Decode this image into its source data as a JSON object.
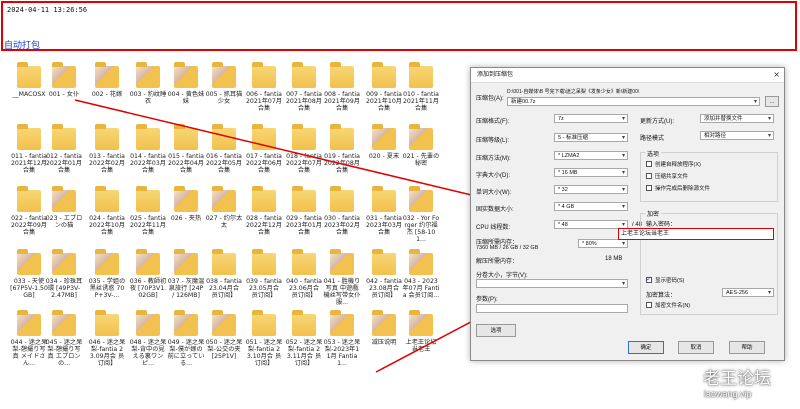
{
  "topbar": {
    "timestamp": "2024-04-11   13:26:56",
    "autopack": "自动打包"
  },
  "explorer": {
    "items": [
      {
        "label": "__MACOSX",
        "kind": "folder"
      },
      {
        "label": "001 - 女仆",
        "kind": "thumb"
      },
      {
        "label": "002 - 花嫁",
        "kind": "thumb"
      },
      {
        "label": "003 - 豹纹睡衣",
        "kind": "thumb"
      },
      {
        "label": "004 - 黄色妹妹",
        "kind": "thumb"
      },
      {
        "label": "005 - 抓耳猫少女",
        "kind": "thumb"
      },
      {
        "label": "006 - fantia 2021年07月合集",
        "kind": "folder"
      },
      {
        "label": "007 - fantia 2021年08月合集",
        "kind": "folder"
      },
      {
        "label": "008 - fantia 2021年09月合集",
        "kind": "folder"
      },
      {
        "label": "009 - fantia 2021年10月合集",
        "kind": "folder"
      },
      {
        "label": "010 - fantia 2021年11月合集",
        "kind": "folder"
      },
      {
        "label": "011 - fantia 2021年12月合集",
        "kind": "folder"
      },
      {
        "label": "012 - fantia 2022年01月合集",
        "kind": "folder"
      },
      {
        "label": "013 - fantia 2022年02月合集",
        "kind": "folder"
      },
      {
        "label": "014 - fantia 2022年03月合集",
        "kind": "folder"
      },
      {
        "label": "015 - fantia 2022年04月合集",
        "kind": "folder"
      },
      {
        "label": "016 - fantia 2022年05月合集",
        "kind": "folder"
      },
      {
        "label": "017 - fantia 2022年06月合集",
        "kind": "folder"
      },
      {
        "label": "018 - fantia 2022年07月合集",
        "kind": "folder"
      },
      {
        "label": "019 - fantia 2022年08月合集",
        "kind": "folder"
      },
      {
        "label": "020 - 夏末",
        "kind": "thumb"
      },
      {
        "label": "021 - 先輩の秘密",
        "kind": "thumb"
      },
      {
        "label": "022 - fantia 2022年09月合集",
        "kind": "folder"
      },
      {
        "label": "023 - エプロンの猫",
        "kind": "thumb"
      },
      {
        "label": "024 - fantia 2022年10月合集",
        "kind": "folder"
      },
      {
        "label": "025 - fantia 2022年11月合集",
        "kind": "folder"
      },
      {
        "label": "026 - 夹热",
        "kind": "thumb"
      },
      {
        "label": "027 - 约尔太太",
        "kind": "thumb"
      },
      {
        "label": "028 - fantia 2022年12月合集",
        "kind": "folder"
      },
      {
        "label": "029 - fantia 2023年01月合集",
        "kind": "folder"
      },
      {
        "label": "030 - fantia 2023年02月合集",
        "kind": "folder"
      },
      {
        "label": "031 - fantia 2023年03月合集",
        "kind": "folder"
      },
      {
        "label": "032 - Yor Forger 约尔福杰 [58-101...",
        "kind": "thumb"
      },
      {
        "label": "033 - 天使 [67P5V-1.50GB]",
        "kind": "thumb"
      },
      {
        "label": "034 - 珍珠耳環 [49P3V-2.47MB]",
        "kind": "thumb"
      },
      {
        "label": "035 - 学姐の黑丝诱惑 70P+3V-...",
        "kind": "thumb"
      },
      {
        "label": "036 - 教師初夜 [70P3V1.02GB]",
        "kind": "thumb"
      },
      {
        "label": "037 - 灰魔温泉旅行 [24P / 126MB]",
        "kind": "thumb"
      },
      {
        "label": "038 - fantia 23.04月合 员订阅】",
        "kind": "folder"
      },
      {
        "label": "039 - fantia 23.05月合 员订阅】",
        "kind": "folder"
      },
      {
        "label": "040 - fantia 23.06月合 员订阅】",
        "kind": "folder"
      },
      {
        "label": "041 - 胜機り写真 中遊戲機丝写带女仆服...",
        "kind": "thumb"
      },
      {
        "label": "042 - fantia 23.08月合 员订阅】",
        "kind": "folder"
      },
      {
        "label": "043 - 2023年07月 Fantia 会员订阅...",
        "kind": "thumb"
      },
      {
        "label": "044 - 迷之呆梨-憩撮り写真 メイドさん...",
        "kind": "thumb"
      },
      {
        "label": "045 - 迷之呆梨-憩撮り写真 エプロンの...",
        "kind": "thumb"
      },
      {
        "label": "046 - 迷之呆梨-fantia 23.09月会 员订阅】",
        "kind": "folder"
      },
      {
        "label": "048 - 迷之呆梨-背中の見える裏ワンピ...",
        "kind": "thumb"
      },
      {
        "label": "049 - 迷之呆梨-僕が嫁の前に立っている...",
        "kind": "thumb"
      },
      {
        "label": "050 - 迷之呆梨-公交の夹 [25P1V]",
        "kind": "thumb"
      },
      {
        "label": "051 - 迷之呆梨-fantia 23.10月合 员订阅】",
        "kind": "folder"
      },
      {
        "label": "052 - 迷之呆梨-fantia 23.11月合 员订阅】",
        "kind": "folder"
      },
      {
        "label": "053 - 迷之呆梨-2023年11月 Fantia 1...",
        "kind": "thumb"
      },
      {
        "label": "减压说明",
        "kind": "thumb"
      },
      {
        "label": "上老王论坛 当老王",
        "kind": "thumb"
      }
    ]
  },
  "dialog": {
    "title": "添加到压缩包",
    "close": "×",
    "archive_label": "压缩包(A):",
    "archive_path": "D:\\001-自媒体\\B 号完下载\\迷之呆梨《发条少女》新\\新建00\\",
    "archive_name": "新建00.7z",
    "browse": "...",
    "format_label": "压缩格式(F):",
    "format_value": "7z",
    "level_label": "压缩等级(L):",
    "level_value": "5 - 标准压缩",
    "method_label": "压缩方法(M):",
    "method_value": "* LZMA2",
    "dict_label": "字典大小(D):",
    "dict_value": "* 16 MB",
    "word_label": "单词大小(W):",
    "word_value": "* 32",
    "solid_label": "固实数据大小:",
    "solid_value": "* 4 GB",
    "cpu_label": "CPU 线程数:",
    "cpu_value": "* 48",
    "cpu_max": "/ 48",
    "mem_label": "压缩所需内存：",
    "mem_value": "7360 MB / 26 GB / 32 GB",
    "mem_pct": "* 80%",
    "decomp_label": "解压所需内存：",
    "decomp_value": "18 MB",
    "split_label": "分卷大小，字节(V):",
    "params_label": "参数(P):",
    "options_btn": "选项",
    "update_label": "更新方式(U):",
    "update_value": "添加并替换文件",
    "path_label": "路径模式",
    "path_value": "相对路径",
    "opts_title": "选项",
    "opt1": "创建自释放程序(X)",
    "opt2": "压缩共享文件",
    "opt3": "操作完成后删除源文件",
    "enc_title": "加密",
    "pw_label": "输入密码：",
    "pw_value": "上老王论坛当老王",
    "show_pw": "显示密码(S)",
    "enc_method_label": "加密算法：",
    "enc_method_value": "AES-256",
    "enc_names": "加密文件名(N)",
    "ok": "确定",
    "cancel": "取消",
    "help": "帮助"
  },
  "watermark": {
    "line1": "老王论坛",
    "line2": "laowang.vip"
  },
  "colors": {
    "highlight": "#e00000",
    "accent": "#1a3cc8"
  }
}
